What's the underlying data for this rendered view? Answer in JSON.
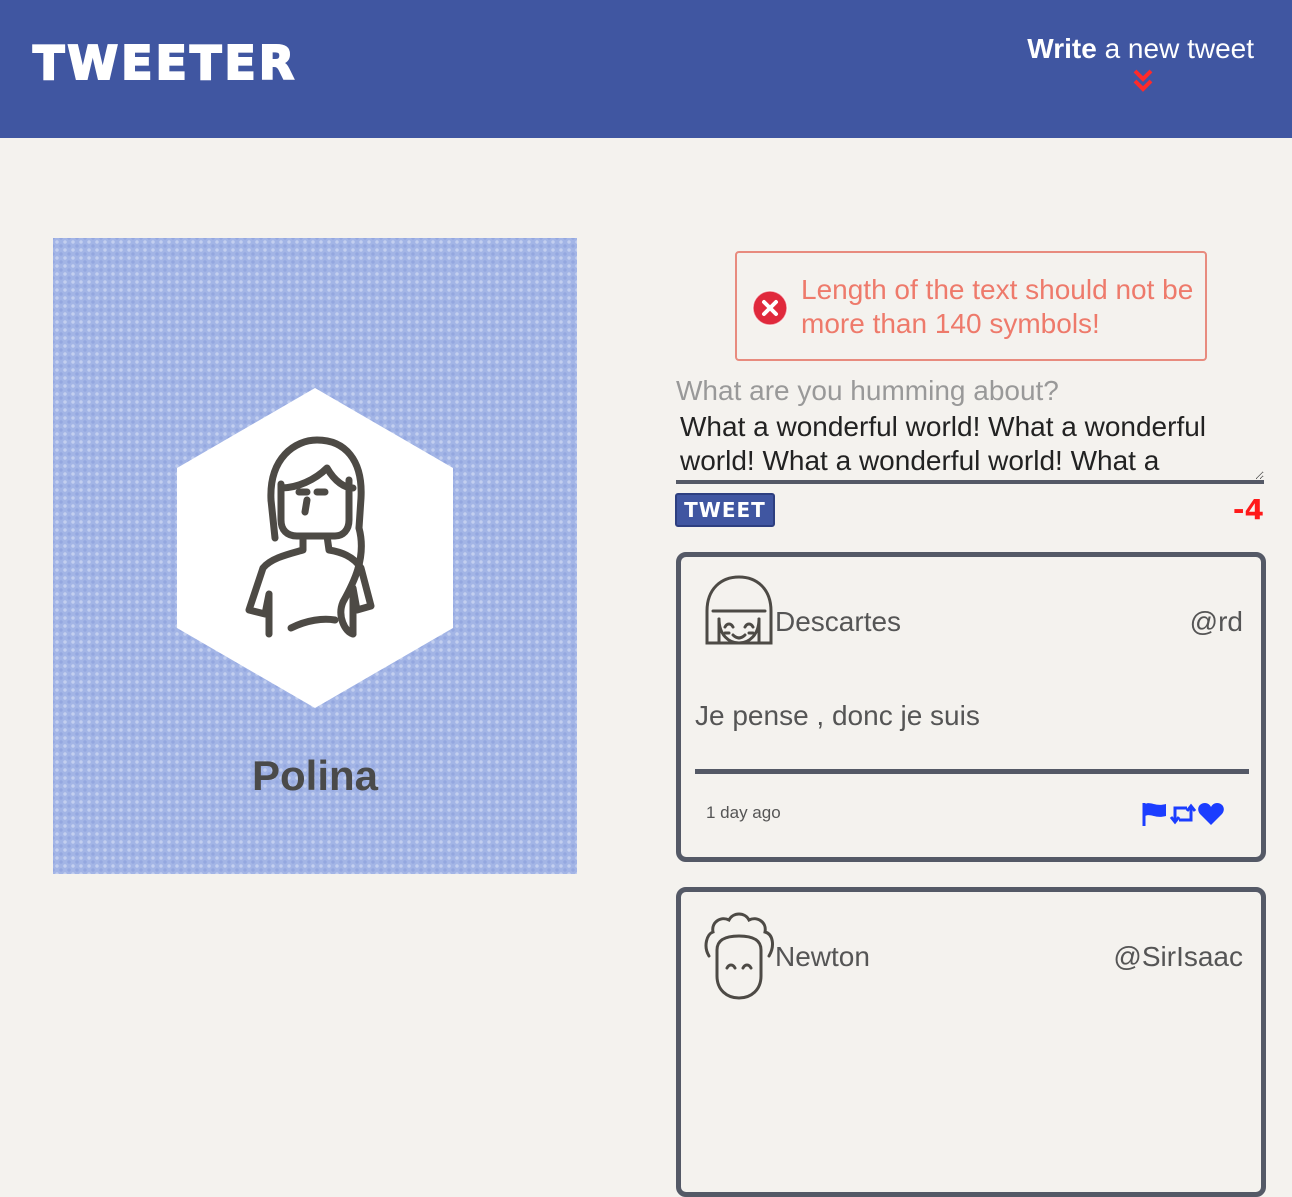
{
  "header": {
    "logo": "TWEETER",
    "compose_toggle": {
      "bold": "Write",
      "rest": " a new tweet"
    },
    "chevron_icon": "double-chevron-down-icon",
    "background": "#4056a1"
  },
  "profile": {
    "name": "Polina",
    "avatar_icon": "girl-avatar-icon"
  },
  "compose": {
    "error": "Length of the text should not be more than 140 symbols!",
    "label": "What are you humming about?",
    "text": "What a wonderful world! What a wonderful world! What a wonderful world! What a",
    "button_label": "TWEET",
    "counter": "-4"
  },
  "tweets": [
    {
      "name": "Descartes",
      "handle": "@rd",
      "content": "Je pense , donc je suis",
      "time": "1 day ago",
      "actions": [
        "flag-icon",
        "retweet-icon",
        "heart-icon"
      ]
    },
    {
      "name": "Newton",
      "handle": "@SirIsaac"
    }
  ],
  "colors": {
    "accent": "#4056a1",
    "error": "#ee7a6b",
    "counter_negative": "#ff1a1a",
    "action_icons": "#1b3dff"
  }
}
